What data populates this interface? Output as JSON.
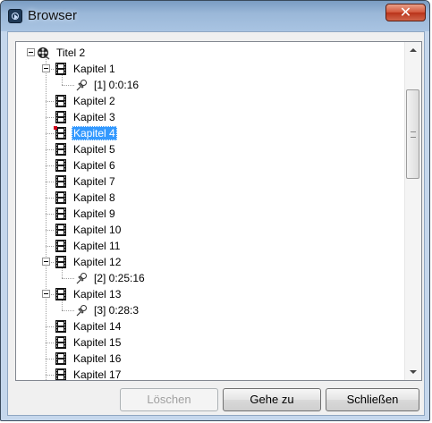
{
  "window": {
    "title": "Browser"
  },
  "tree": {
    "nodes": [
      {
        "label": "Titel 2",
        "icon": "reel-icon",
        "expander": true,
        "selected": false
      },
      {
        "label": "Kapitel 1",
        "icon": "film-icon",
        "expander": true,
        "selected": false
      },
      {
        "label": "[1]  0:0:16",
        "icon": "pushpin-icon",
        "expander": false,
        "selected": false
      },
      {
        "label": "Kapitel 2",
        "icon": "film-icon",
        "expander": false,
        "selected": false
      },
      {
        "label": "Kapitel 3",
        "icon": "film-icon",
        "expander": false,
        "selected": false
      },
      {
        "label": "Kapitel 4",
        "icon": "film-icon",
        "expander": false,
        "selected": true
      },
      {
        "label": "Kapitel 5",
        "icon": "film-icon",
        "expander": false,
        "selected": false
      },
      {
        "label": "Kapitel 6",
        "icon": "film-icon",
        "expander": false,
        "selected": false
      },
      {
        "label": "Kapitel 7",
        "icon": "film-icon",
        "expander": false,
        "selected": false
      },
      {
        "label": "Kapitel 8",
        "icon": "film-icon",
        "expander": false,
        "selected": false
      },
      {
        "label": "Kapitel 9",
        "icon": "film-icon",
        "expander": false,
        "selected": false
      },
      {
        "label": "Kapitel 10",
        "icon": "film-icon",
        "expander": false,
        "selected": false
      },
      {
        "label": "Kapitel 11",
        "icon": "film-icon",
        "expander": false,
        "selected": false
      },
      {
        "label": "Kapitel 12",
        "icon": "film-icon",
        "expander": true,
        "selected": false
      },
      {
        "label": "[2]  0:25:16",
        "icon": "pushpin-icon",
        "expander": false,
        "selected": false
      },
      {
        "label": "Kapitel 13",
        "icon": "film-icon",
        "expander": true,
        "selected": false
      },
      {
        "label": "[3]  0:28:3",
        "icon": "pushpin-icon",
        "expander": false,
        "selected": false
      },
      {
        "label": "Kapitel 14",
        "icon": "film-icon",
        "expander": false,
        "selected": false
      },
      {
        "label": "Kapitel 15",
        "icon": "film-icon",
        "expander": false,
        "selected": false
      },
      {
        "label": "Kapitel 16",
        "icon": "film-icon",
        "expander": false,
        "selected": false
      },
      {
        "label": "Kapitel 17",
        "icon": "film-icon",
        "expander": false,
        "selected": false
      }
    ]
  },
  "buttons": {
    "delete": "Löschen",
    "goto": "Gehe zu",
    "close": "Schließen"
  },
  "colors": {
    "selection": "#3399ff",
    "close_button": "#c8462b",
    "marker": "#d0021b"
  }
}
